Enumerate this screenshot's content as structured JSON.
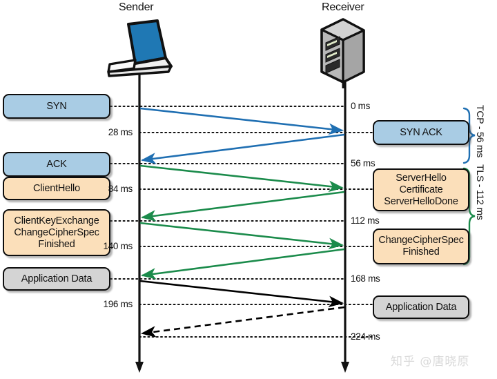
{
  "endpoints": {
    "sender": {
      "label": "Sender",
      "icon": "laptop-icon"
    },
    "receiver": {
      "label": "Receiver",
      "icon": "server-icon"
    }
  },
  "colors": {
    "tcp_blue": "#1f6fb2",
    "tls_green": "#1b8b4b",
    "app_black": "#000000",
    "box_blue": "#a9cce4",
    "box_orange": "#fbdfba",
    "box_gray": "#d4d4d4",
    "outline": "#0d0d0d"
  },
  "left_messages": [
    {
      "text": "SYN",
      "tone": "blue",
      "lines": [
        "SYN"
      ]
    },
    {
      "text": "ACK",
      "tone": "blue",
      "lines": [
        "ACK"
      ]
    },
    {
      "text": "ClientHello",
      "tone": "orange",
      "lines": [
        "ClientHello"
      ]
    },
    {
      "text": "ClientKeyExchange ChangeCipherSpec Finished",
      "tone": "orange",
      "lines": [
        "ClientKeyExchange",
        "ChangeCipherSpec",
        "Finished"
      ]
    },
    {
      "text": "Application Data",
      "tone": "gray",
      "lines": [
        "Application Data"
      ]
    }
  ],
  "right_messages": [
    {
      "text": "SYN ACK",
      "tone": "blue",
      "lines": [
        "SYN ACK"
      ]
    },
    {
      "text": "ServerHello Certificate ServerHelloDone",
      "tone": "orange",
      "lines": [
        "ServerHello",
        "Certificate",
        "ServerHelloDone"
      ]
    },
    {
      "text": "ChangeCipherSpec Finished",
      "tone": "orange",
      "lines": [
        "ChangeCipherSpec",
        "Finished"
      ]
    },
    {
      "text": "Application Data",
      "tone": "gray",
      "lines": [
        "Application Data"
      ]
    }
  ],
  "left_ticks": [
    {
      "label": "28 ms"
    },
    {
      "label": "84 ms"
    },
    {
      "label": "140 ms"
    },
    {
      "label": "196 ms"
    }
  ],
  "right_ticks": [
    {
      "label": "0 ms"
    },
    {
      "label": "56 ms"
    },
    {
      "label": "112 ms"
    },
    {
      "label": "168 ms"
    },
    {
      "label": "224 ms"
    }
  ],
  "braces": [
    {
      "label": "TCP - 56 ms",
      "color": "#1f6fb2"
    },
    {
      "label": "TLS - 112 ms",
      "color": "#1b8b4b"
    }
  ],
  "watermark": {
    "text": "知乎 @唐晓原"
  }
}
